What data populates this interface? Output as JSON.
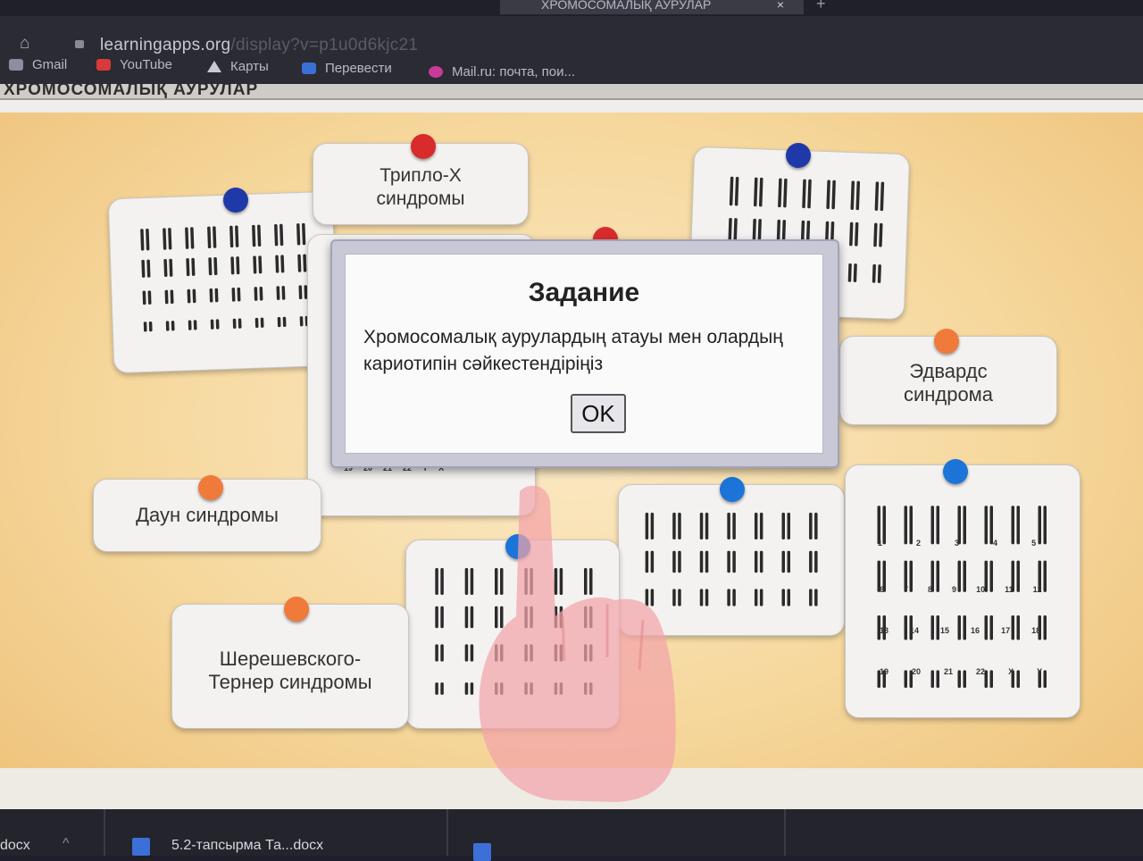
{
  "browser": {
    "tab_title": "ХРОМОСОМАЛЫҚ АУРУЛАР",
    "tab_close": "×",
    "new_tab": "+",
    "url_host": "learningapps.org",
    "url_path": "/display?v=p1u0d6kjc21",
    "bookmarks": [
      {
        "label": "Gmail",
        "icon": "gmail-icon",
        "color": "#8a8ea0"
      },
      {
        "label": "YouTube",
        "icon": "youtube-icon",
        "color": "#d63a3a"
      },
      {
        "label": "Карты",
        "icon": "maps-icon",
        "color": "#c9c9d6"
      },
      {
        "label": "Перевести",
        "icon": "translate-icon",
        "color": "#3a6fd6"
      },
      {
        "label": "Mail.ru: почта, пои...",
        "icon": "mailru-icon",
        "color": "#c83a9a"
      }
    ]
  },
  "page": {
    "heading": "ХРОМОСОМАЛЫҚ АУРУЛАР"
  },
  "labels": {
    "triplo_x": "Трипло-Х синдромы",
    "edwards": "Эдвардс синдрома",
    "down": "Даун синдромы",
    "turner": "Шерешевского-Тернер синдромы"
  },
  "karyotype_numbers": {
    "row_a": [
      "1",
      "2",
      "3",
      "4",
      "5"
    ],
    "row_b": [
      "6",
      "7",
      "8",
      "9",
      "10",
      "11",
      "12"
    ],
    "row_c": [
      "13",
      "14",
      "15",
      "16",
      "17",
      "18"
    ],
    "row_d": [
      "19",
      "20",
      "21",
      "22",
      "X",
      "Y"
    ],
    "middle_row": [
      "19",
      "20",
      "21",
      "22",
      "Y",
      "X"
    ]
  },
  "modal": {
    "title": "Задание",
    "text": "Хромосомалық аурулардың атауы мен олардың кариотипін сәйкестендіріңіз",
    "ok_label": "OK"
  },
  "taskbar": {
    "item1": "docx",
    "item2": "5.2-тапсырма Та...docx"
  },
  "colors": {
    "pin_red": "#d92b2b",
    "pin_blue": "#1f3aa8",
    "pin_lightblue": "#1c74d8",
    "pin_orange": "#f07a3a",
    "background": "#f6d89d"
  }
}
